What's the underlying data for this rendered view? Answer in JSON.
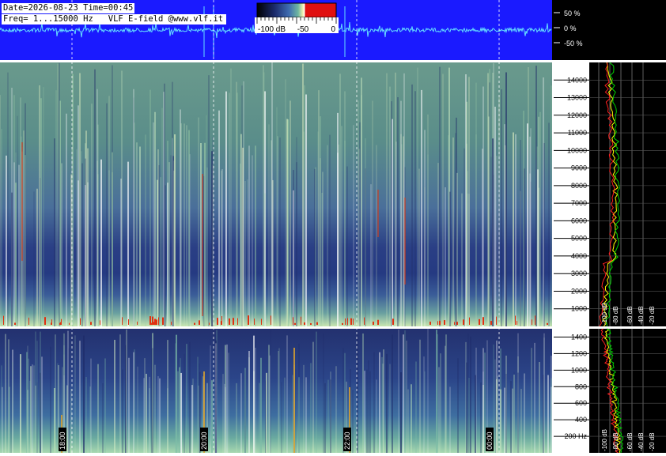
{
  "header": {
    "datetime": "Date=2026-08-23 Time=00:45",
    "freq_label": "Freq= 1...15000 Hz",
    "source": "VLF E-field @www.vlf.it"
  },
  "colorbar": {
    "ticks": [
      "-100 dB",
      "-50",
      "0"
    ],
    "colors": [
      "#000000",
      "#1b2a6b",
      "#3e6bb0",
      "#6fb7a0",
      "#f2f2b0",
      "#ffffff",
      "#e01010"
    ]
  },
  "waveform": {
    "scale_labels": [
      "50 %",
      "0 %",
      "-50 %"
    ],
    "background": "#1a1aff",
    "trace_color": "#66e0ff"
  },
  "chart_data": [
    {
      "type": "heatmap",
      "name_printed": "",
      "x_ticks": [
        "18:00",
        "20:00",
        "22:00",
        "00:00"
      ],
      "y_ticks": [
        "1000",
        "2000",
        "3000",
        "4000",
        "5000",
        "6000",
        "7000",
        "8000",
        "9000",
        "10000",
        "11000",
        "12000",
        "13000",
        "14000"
      ],
      "ylim": [
        0,
        15000
      ],
      "colorbar_range_db": [
        -100,
        0
      ],
      "grid": true
    },
    {
      "type": "heatmap",
      "x_ticks": [
        "18:00",
        "20:00",
        "22:00",
        "00:00"
      ],
      "y_ticks": [
        "200 Hz",
        "400",
        "600",
        "800",
        "1000",
        "1200",
        "1400"
      ],
      "ylim": [
        0,
        1500
      ],
      "grid": true
    },
    {
      "type": "line",
      "y_ticks": [
        "1000",
        "2000",
        "3000",
        "4000",
        "5000",
        "6000",
        "7000",
        "8000",
        "9000",
        "10000",
        "11000",
        "12000",
        "13000",
        "14000"
      ],
      "x_ticks": [
        "-100 dB",
        "-80 dB",
        "-60 dB",
        "-40 dB",
        "-20 dB"
      ],
      "series_colors": [
        "#ffff00",
        "#ff2020",
        "#00d000"
      ],
      "ylim": [
        0,
        15000
      ]
    },
    {
      "type": "line",
      "y_ticks": [
        "200 Hz",
        "400",
        "600",
        "800",
        "1000",
        "1200",
        "1400"
      ],
      "x_ticks": [
        "-100 dB",
        "-80 dB",
        "-60 dB",
        "-40 dB",
        "-20 dB"
      ],
      "series_colors": [
        "#ffff00",
        "#ff2020",
        "#00d000"
      ],
      "ylim": [
        0,
        1500
      ]
    }
  ]
}
